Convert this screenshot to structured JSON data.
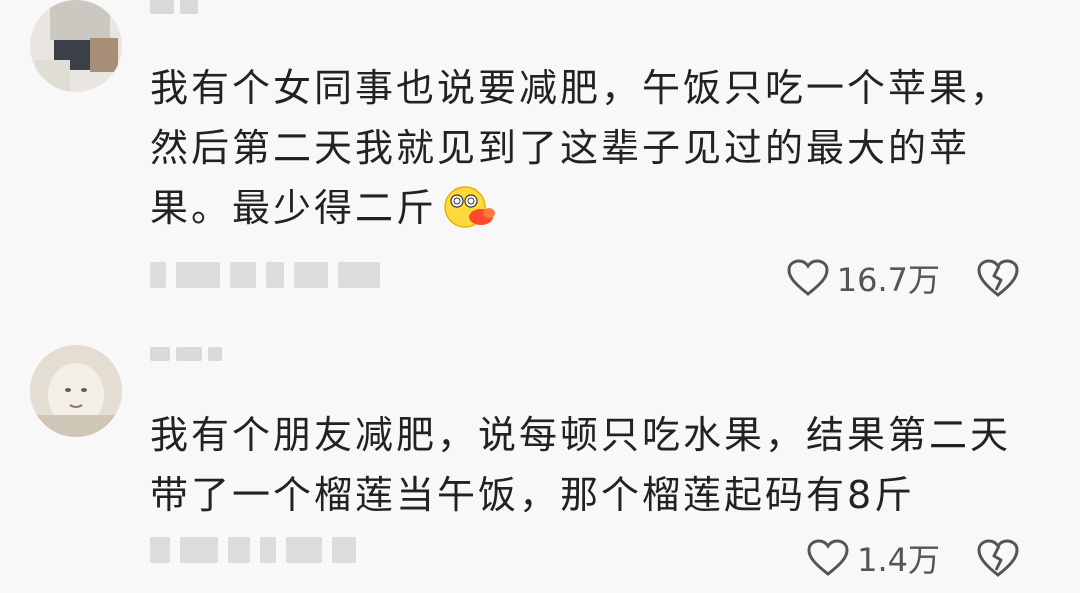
{
  "comments": [
    {
      "text": "我有个女同事也说要减肥，午饭只吃一个苹果，然后第二天我就见到了这辈子见过的最大的苹果。最少得二斤",
      "emoji": "dizzy-surprised-face",
      "likes": "16.7万",
      "icons": {
        "like": "heart-outline-icon",
        "dislike": "broken-heart-icon"
      }
    },
    {
      "text": "我有个朋友减肥，说每顿只吃水果，结果第二天带了一个榴莲当午饭，那个榴莲起码有8斤",
      "likes": "1.4万",
      "icons": {
        "like": "heart-outline-icon",
        "dislike": "broken-heart-icon"
      }
    }
  ],
  "colors": {
    "background": "#f8f8f8",
    "text": "#222222",
    "meta": "#555555",
    "blur": "#d9d9d9"
  }
}
